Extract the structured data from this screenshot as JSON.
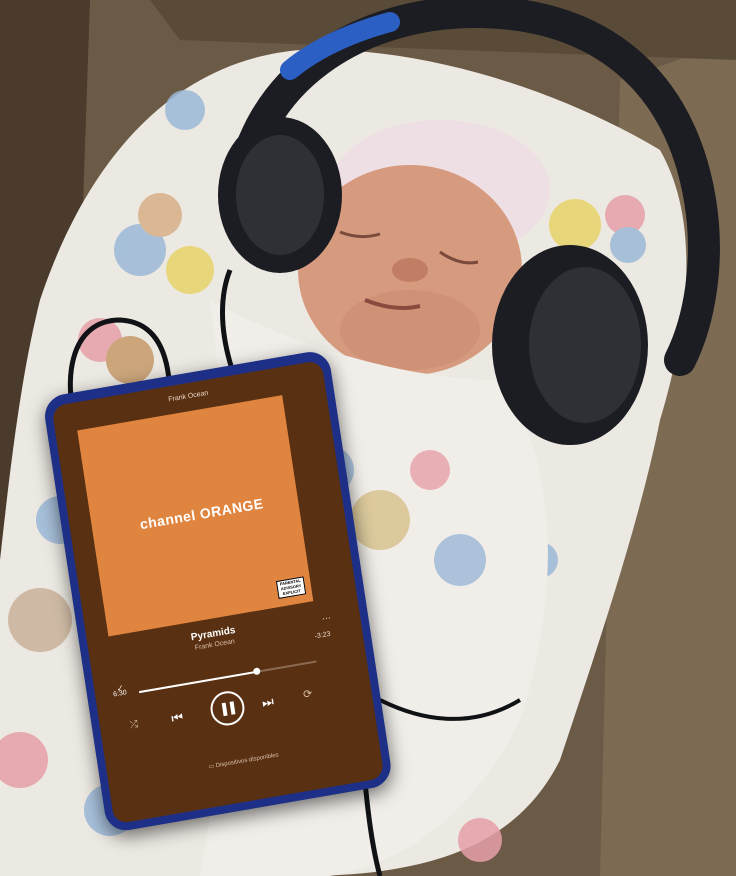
{
  "scene": {
    "colors": {
      "background": "#6b5a45",
      "blanket": "#ece8e2",
      "headphones": "#1c1d22",
      "headband_accent": "#2b5fc4",
      "hat": "#eedfe4",
      "skin": "#d69a7e",
      "phone_body": "#1d2f86",
      "player_bg": "#5a3012",
      "album_art": "#e0853f"
    }
  },
  "phone": {
    "playing_from": "Frank Ocean",
    "album_title": "channel ORANGE",
    "advisory_label": "PARENTAL ADVISORY EXPLICIT CONTENT",
    "track_title": "Pyramids",
    "track_artist": "Frank Ocean",
    "time_elapsed": "6:30",
    "time_remaining": "-3:23",
    "progress_fraction": 0.66,
    "devices_label": "Dispositivos disponibles",
    "icons": {
      "more": "more-icon",
      "heart": "heart-icon",
      "shuffle": "shuffle-icon",
      "previous": "previous-icon",
      "pause": "pause-icon",
      "next": "next-icon",
      "repeat": "repeat-icon",
      "devices": "devices-icon"
    }
  }
}
